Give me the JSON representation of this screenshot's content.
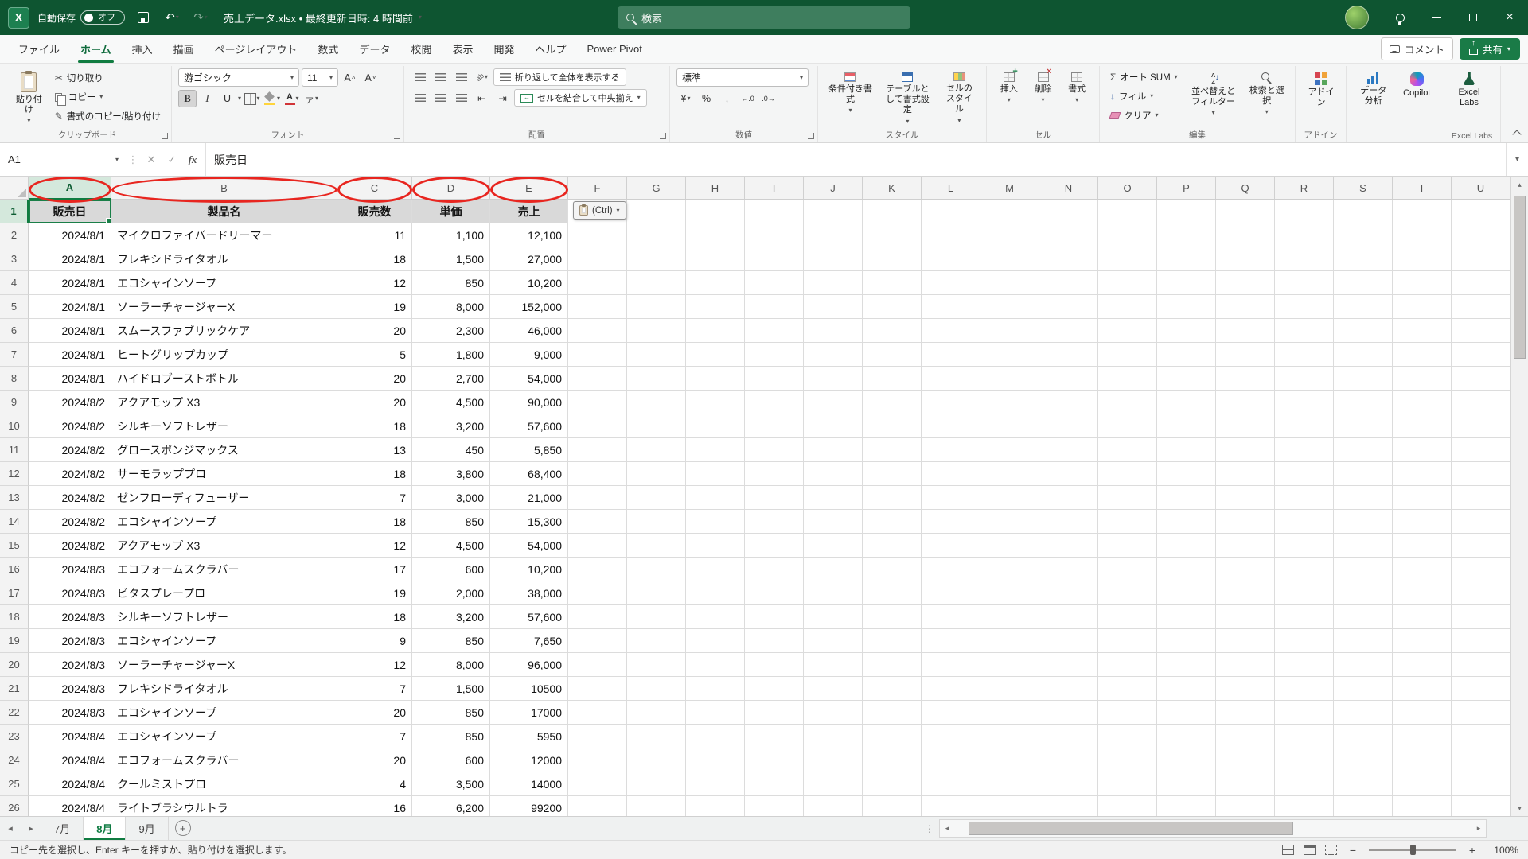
{
  "colors": {
    "excel_green": "#107C41",
    "title_bar_green": "#0E5531",
    "annotation_red": "#E8251F",
    "share_green": "#1A7B47"
  },
  "title_bar": {
    "app_name": "X",
    "autosave_label": "自動保存",
    "autosave_state": "オフ",
    "doc_title": "売上データ.xlsx • 最終更新日時: 4 時間前",
    "search_placeholder": "検索"
  },
  "ribbon_tabs": [
    {
      "id": "file",
      "label": "ファイル",
      "active": false
    },
    {
      "id": "home",
      "label": "ホーム",
      "active": true
    },
    {
      "id": "insert",
      "label": "挿入",
      "active": false
    },
    {
      "id": "draw",
      "label": "描画",
      "active": false
    },
    {
      "id": "page-layout",
      "label": "ページレイアウト",
      "active": false
    },
    {
      "id": "formulas",
      "label": "数式",
      "active": false
    },
    {
      "id": "data",
      "label": "データ",
      "active": false
    },
    {
      "id": "review",
      "label": "校閲",
      "active": false
    },
    {
      "id": "view",
      "label": "表示",
      "active": false
    },
    {
      "id": "developer",
      "label": "開発",
      "active": false
    },
    {
      "id": "help",
      "label": "ヘルプ",
      "active": false
    },
    {
      "id": "power-pivot",
      "label": "Power Pivot",
      "active": false
    }
  ],
  "tab_row_right": {
    "comments": "コメント",
    "share": "共有"
  },
  "ribbon": {
    "clipboard": {
      "group": "クリップボード",
      "paste": "貼り付け",
      "cut": "切り取り",
      "copy": "コピー",
      "format_painter": "書式のコピー/貼り付け"
    },
    "font": {
      "group": "フォント",
      "name": "游ゴシック",
      "size": "11",
      "bold": "B",
      "italic": "I",
      "underline": "U",
      "ruby": "ァ"
    },
    "alignment": {
      "group": "配置",
      "wrap": "折り返して全体を表示する",
      "merge": "セルを結合して中央揃え"
    },
    "number": {
      "group": "数値",
      "format": "標準",
      "currency": "¥",
      "percent": "%",
      "comma": ",",
      "dec_inc": "←.0",
      "dec_dec": ".0→"
    },
    "styles": {
      "group": "スタイル",
      "conditional": "条件付き書式",
      "table": "テーブルとして書式設定",
      "cell_styles": "セルのスタイル"
    },
    "cells": {
      "group": "セル",
      "insert": "挿入",
      "delete": "削除",
      "format": "書式"
    },
    "editing": {
      "group": "編集",
      "autosum": "オート SUM",
      "fill": "フィル",
      "clear": "クリア",
      "sort": "並べ替えとフィルター",
      "find": "検索と選択"
    },
    "addins": {
      "group": "アドイン",
      "button": "アドイン"
    },
    "analyze": {
      "label": "データ分析"
    },
    "copilot": {
      "label": "Copilot"
    },
    "labs": {
      "group": "Excel Labs",
      "label": "Excel Labs"
    }
  },
  "formula_bar": {
    "name_box": "A1",
    "value": "販売日",
    "fx": "fx",
    "cancel": "✕",
    "enter": "✓"
  },
  "grid": {
    "columns": [
      "A",
      "B",
      "C",
      "D",
      "E",
      "F",
      "G",
      "H",
      "I",
      "J",
      "K",
      "L",
      "M",
      "N",
      "O",
      "P",
      "Q",
      "R",
      "S",
      "T",
      "U"
    ],
    "row_count": 26,
    "active_cell": "A1",
    "header_row": [
      "販売日",
      "製品名",
      "販売数",
      "単価",
      "売上"
    ],
    "rows": [
      [
        "2024/8/1",
        "マイクロファイバードリーマー",
        "11",
        "1,100",
        "12,100"
      ],
      [
        "2024/8/1",
        "フレキシドライタオル",
        "18",
        "1,500",
        "27,000"
      ],
      [
        "2024/8/1",
        "エコシャインソープ",
        "12",
        "850",
        "10,200"
      ],
      [
        "2024/8/1",
        "ソーラーチャージャーX",
        "19",
        "8,000",
        "152,000"
      ],
      [
        "2024/8/1",
        "スムースファブリックケア",
        "20",
        "2,300",
        "46,000"
      ],
      [
        "2024/8/1",
        "ヒートグリップカップ",
        "5",
        "1,800",
        "9,000"
      ],
      [
        "2024/8/1",
        "ハイドロブーストボトル",
        "20",
        "2,700",
        "54,000"
      ],
      [
        "2024/8/2",
        "アクアモップ X3",
        "20",
        "4,500",
        "90,000"
      ],
      [
        "2024/8/2",
        "シルキーソフトレザー",
        "18",
        "3,200",
        "57,600"
      ],
      [
        "2024/8/2",
        "グロースポンジマックス",
        "13",
        "450",
        "5,850"
      ],
      [
        "2024/8/2",
        "サーモラッププロ",
        "18",
        "3,800",
        "68,400"
      ],
      [
        "2024/8/2",
        "ゼンフローディフューザー",
        "7",
        "3,000",
        "21,000"
      ],
      [
        "2024/8/2",
        "エコシャインソープ",
        "18",
        "850",
        "15,300"
      ],
      [
        "2024/8/2",
        "アクアモップ X3",
        "12",
        "4,500",
        "54,000"
      ],
      [
        "2024/8/3",
        "エコフォームスクラバー",
        "17",
        "600",
        "10,200"
      ],
      [
        "2024/8/3",
        "ビタスプレープロ",
        "19",
        "2,000",
        "38,000"
      ],
      [
        "2024/8/3",
        "シルキーソフトレザー",
        "18",
        "3,200",
        "57,600"
      ],
      [
        "2024/8/3",
        "エコシャインソープ",
        "9",
        "850",
        "7,650"
      ],
      [
        "2024/8/3",
        "ソーラーチャージャーX",
        "12",
        "8,000",
        "96,000"
      ],
      [
        "2024/8/3",
        "フレキシドライタオル",
        "7",
        "1,500",
        "10500"
      ],
      [
        "2024/8/3",
        "エコシャインソープ",
        "20",
        "850",
        "17000"
      ],
      [
        "2024/8/4",
        "エコシャインソープ",
        "7",
        "850",
        "5950"
      ],
      [
        "2024/8/4",
        "エコフォームスクラバー",
        "20",
        "600",
        "12000"
      ],
      [
        "2024/8/4",
        "クールミストプロ",
        "4",
        "3,500",
        "14000"
      ],
      [
        "2024/8/4",
        "ライトブラシウルトラ",
        "16",
        "6,200",
        "99200"
      ]
    ],
    "paste_button": "(Ctrl)"
  },
  "sheet_tabs": [
    {
      "id": "jul",
      "label": "7月",
      "active": false
    },
    {
      "id": "aug",
      "label": "8月",
      "active": true
    },
    {
      "id": "sep",
      "label": "9月",
      "active": false
    }
  ],
  "status_bar": {
    "message": "コピー先を選択し、Enter キーを押すか、貼り付けを選択します。",
    "zoom": "100%"
  }
}
